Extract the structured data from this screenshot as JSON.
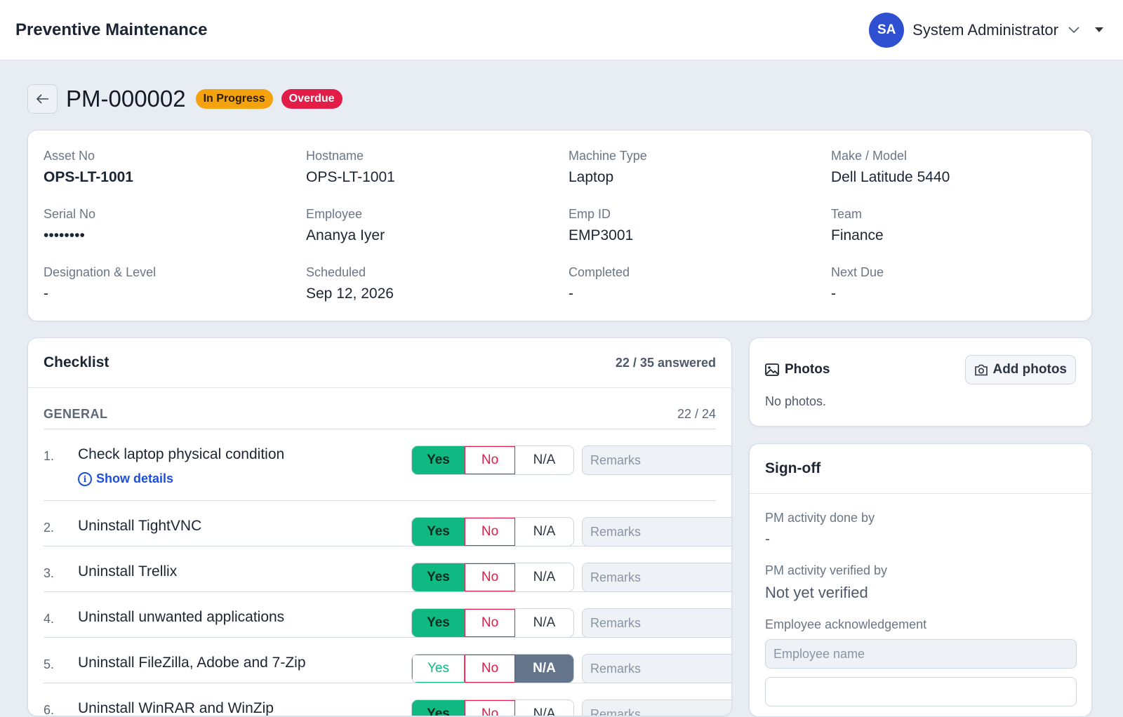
{
  "header": {
    "app_title": "Preventive Maintenance",
    "user_initials": "SA",
    "user_name": "System Administrator"
  },
  "record": {
    "id": "PM-000002",
    "badges": [
      "In Progress",
      "Overdue"
    ]
  },
  "info": {
    "fields": [
      {
        "label": "Asset No",
        "value": "OPS-LT-1001"
      },
      {
        "label": "Hostname",
        "value": "OPS-LT-1001"
      },
      {
        "label": "Machine Type",
        "value": "Laptop"
      },
      {
        "label": "Make / Model",
        "value": "Dell Latitude 5440"
      },
      {
        "label": "Serial No",
        "value": "••••••••"
      },
      {
        "label": "Employee",
        "value": "Ananya Iyer"
      },
      {
        "label": "Emp ID",
        "value": "EMP3001"
      },
      {
        "label": "Team",
        "value": "Finance"
      },
      {
        "label": "Designation & Level",
        "value": "-"
      },
      {
        "label": "Scheduled",
        "value": "Sep 12, 2026"
      },
      {
        "label": "Completed",
        "value": "-"
      },
      {
        "label": "Next Due",
        "value": "-"
      }
    ]
  },
  "checklist": {
    "title": "Checklist",
    "answered": "22 / 35 answered",
    "section": {
      "name": "GENERAL",
      "count": "22 / 24"
    },
    "options": {
      "yes": "Yes",
      "no": "No",
      "na": "N/A"
    },
    "remarks_placeholder": "Remarks",
    "show_details": "Show details",
    "items": [
      {
        "num": "1.",
        "label": "Check laptop physical condition",
        "answer": "Yes"
      },
      {
        "num": "2.",
        "label": "Uninstall TightVNC",
        "answer": "Yes"
      },
      {
        "num": "3.",
        "label": "Uninstall Trellix",
        "answer": "Yes"
      },
      {
        "num": "4.",
        "label": "Uninstall unwanted applications",
        "answer": "Yes"
      },
      {
        "num": "5.",
        "label": "Uninstall FileZilla, Adobe and 7-Zip",
        "answer": "N/A"
      },
      {
        "num": "6.",
        "label": "Uninstall WinRAR and WinZip",
        "answer": "Yes"
      }
    ]
  },
  "photos": {
    "title": "Photos",
    "add_label": "Add photos",
    "empty_text": "No photos."
  },
  "signoff": {
    "title": "Sign-off",
    "done_by_label": "PM activity done by",
    "done_by_value": "-",
    "verified_by_label": "PM activity verified by",
    "verified_by_value": "Not yet verified",
    "ack_label": "Employee acknowledgement",
    "employee_placeholder": "Employee name"
  }
}
